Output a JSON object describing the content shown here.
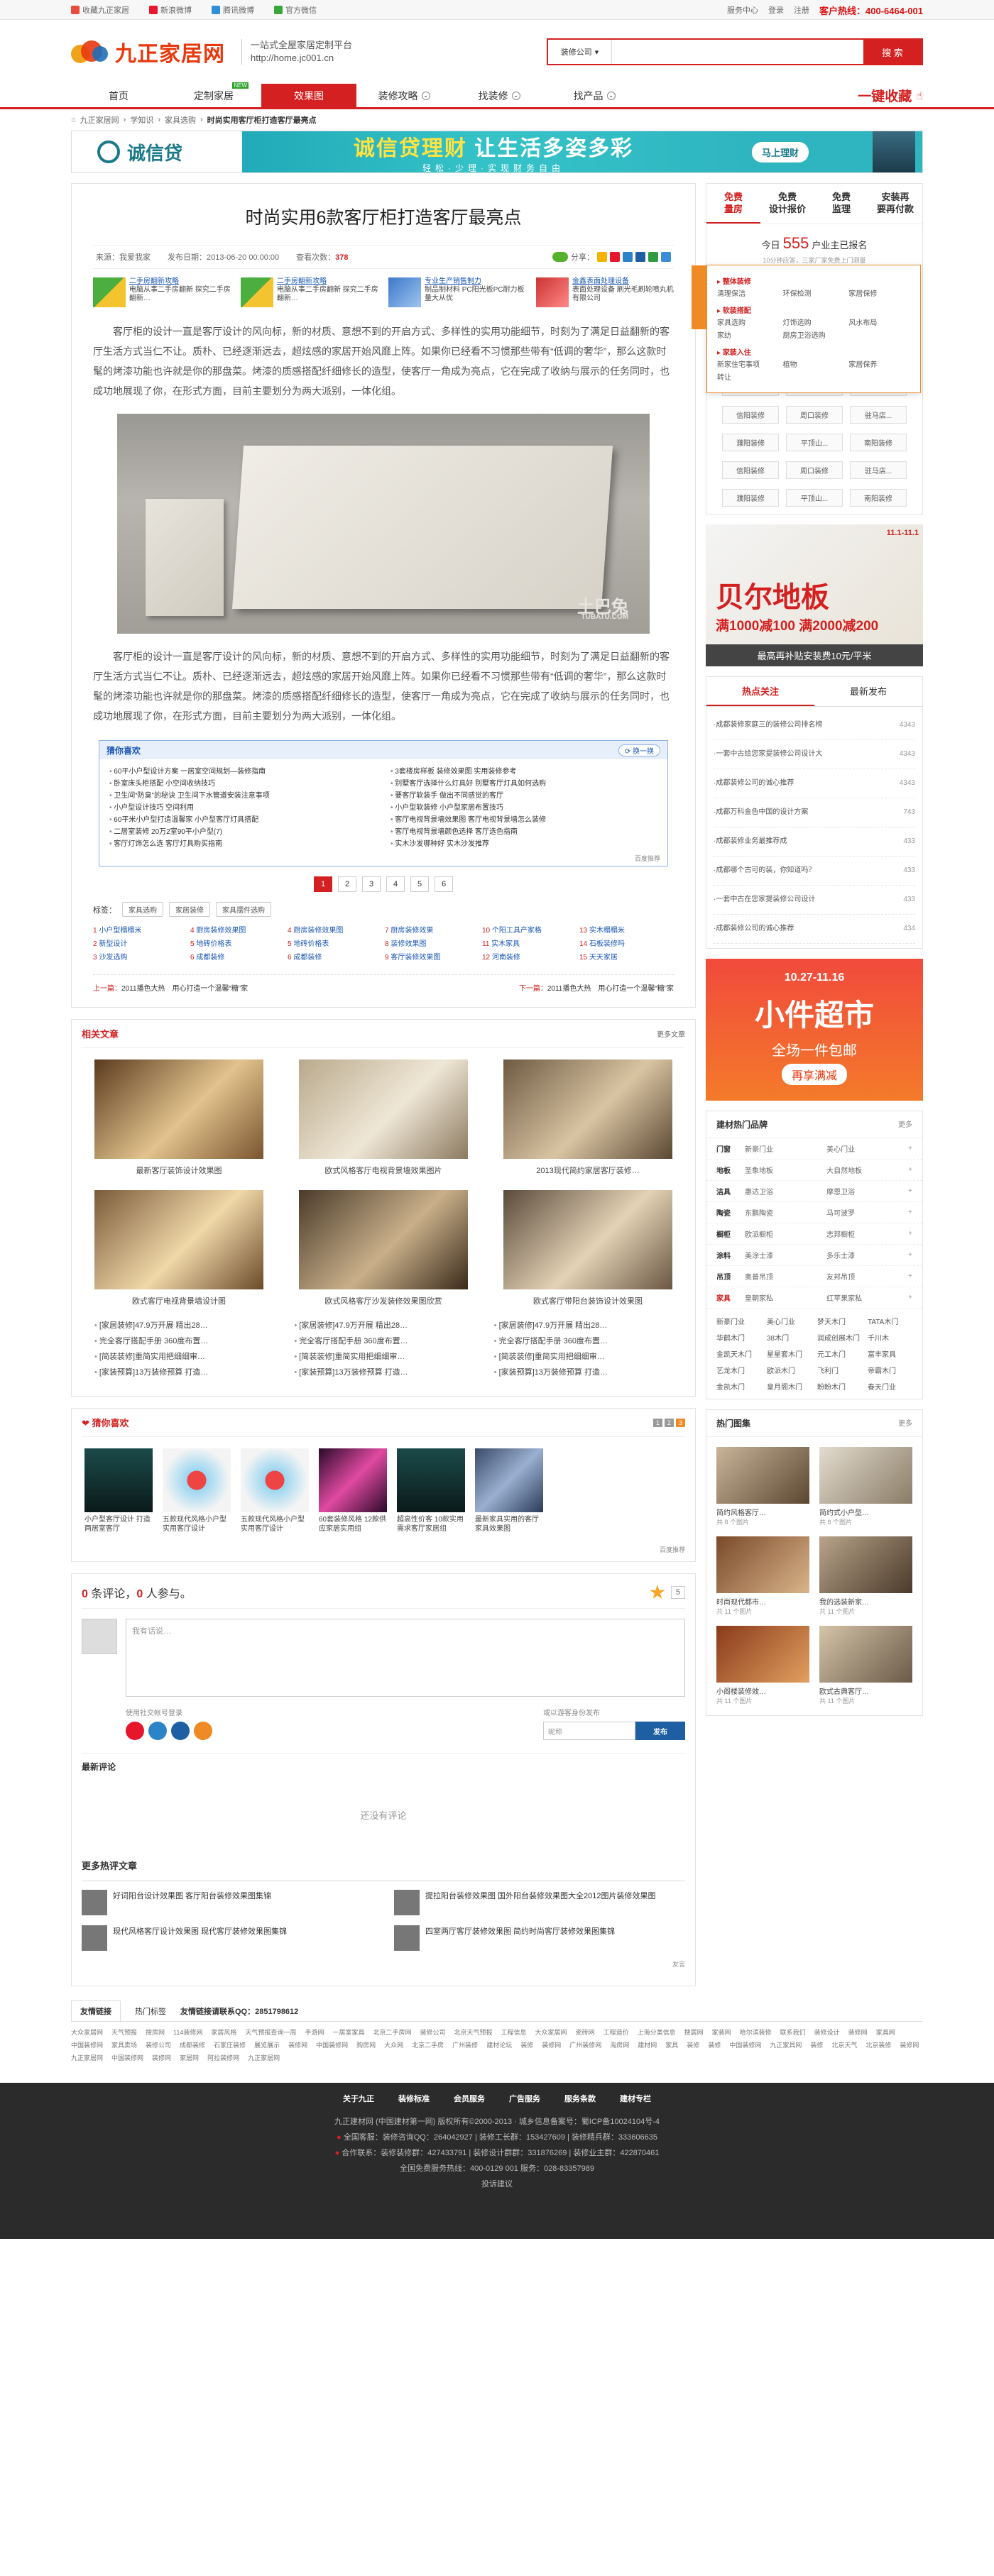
{
  "topbar": {
    "items": [
      "收藏九正家居",
      "新浪微博",
      "腾讯微博",
      "官方微信"
    ],
    "right": [
      "服务中心",
      "登录",
      "注册"
    ],
    "hotline": "客户热线：400-6464-001"
  },
  "logo": {
    "text": "九正家居网",
    "slogan_1": "一站式全屋家居定制平台",
    "slogan_2": "http://home.jc001.cn"
  },
  "search": {
    "select": "装修公司",
    "placeholder": "",
    "button": "搜 索"
  },
  "nav": {
    "items": [
      {
        "label": "首页"
      },
      {
        "label": "定制家居",
        "badge": "NEW"
      },
      {
        "label": "效果图",
        "active": true
      },
      {
        "label": "装修攻略",
        "more": true
      },
      {
        "label": "找装修",
        "more": true
      },
      {
        "label": "找产品",
        "more": true
      }
    ],
    "collect": "一键收藏"
  },
  "breadcrumb": [
    "九正家居网",
    "学知识",
    "家具选购",
    "时尚实用客厅柜打造客厅最亮点"
  ],
  "banner": {
    "brand": "诚信贷",
    "headline_a": "诚信贷理财",
    "headline_b": "让生活多姿多彩",
    "sub": "轻松·少理·实现财务自由",
    "button": "马上理财"
  },
  "article": {
    "title": "时尚实用6款客厅柜打造客厅最亮点",
    "meta": {
      "source": "来源：我爱我家",
      "time": "发布日期：2013-06-20 00:00:00",
      "views_label": "查看次数：",
      "views": "378"
    },
    "share_label": "分享：",
    "ads": [
      {
        "title": "二手房翻新攻略",
        "desc": "电脑从事二手房翻新 探究二手房翻新…"
      },
      {
        "title": "二手房翻新攻略",
        "desc": "电脑从事二手房翻新 探究二手房翻新…"
      },
      {
        "title": "专业生产销售制力",
        "desc": "制品制材料 PC阳光板PC耐力板量大从优"
      },
      {
        "title": "金鑫表面处理设备",
        "desc": "表面处理设备 刷光毛刷轮喷丸机 有限公司"
      }
    ],
    "para1": "客厅柜的设计一直是客厅设计的风向标，新的材质、意想不到的开启方式、多样性的实用功能细节，时刻为了满足日益翻新的客厅生活方式当仁不让。质朴、已经逐渐远去，超炫感的家居开始风靡上阵。如果你已经看不习惯那些带有“低调的奢华”，那么这款时髦的烤漆功能也许就是你的那盘菜。烤漆的质感搭配纤细修长的造型，使客厅一角成为亮点，它在完成了收纳与展示的任务同时，也成功地展现了你，在形式方面，目前主要划分为两大派别，一体化组。",
    "photo_wm": "土巴兔",
    "photo_wm_url": "TUBATU.COM",
    "para2": "客厅柜的设计一直是客厅设计的风向标，新的材质、意想不到的开启方式、多样性的实用功能细节，时刻为了满足日益翻新的客厅生活方式当仁不让。质朴、已经逐渐远去，超炫感的家居开始风靡上阵。如果你已经看不习惯那些带有“低调的奢华”，那么这款时髦的烤漆功能也许就是你的那盘菜。烤漆的质感搭配纤细修长的造型，使客厅一角成为亮点，它在完成了收纳与展示的任务同时，也成功地展现了你，在形式方面，目前主要划分为两大派别，一体化组。",
    "recommend": {
      "title": "猜你喜欢",
      "switch": "换一换",
      "items": [
        "60平小户型设计方案 一居室空间规划—装修指南",
        "3套楼房样板 装修效果图 实用装修参考",
        "卧室床头柜搭配 小空间收纳技巧",
        "别墅客厅选择什么灯具好 别墅客厅灯具如何选购",
        "卫生间“防臭”的秘诀 卫生间下水管道安装注意事项",
        "要客厅软装手 做出不同感觉的客厅",
        "小户型设计技巧 空间利用",
        "小户型软装修 小户型家居布置技巧",
        "60平米小户型打造温馨家 小户型客厅灯具搭配",
        "客厅电视背景墙效果图 客厅电视背景墙怎么装修",
        "二居室装修 20万2室90平小户型(7)",
        "客厅电视背景墙颜色选择 客厅选色指南",
        "客厅灯饰怎么选 客厅灯具购买指南",
        "实木沙发哪种好 实木沙发推荐"
      ],
      "footer": "百度推荐"
    },
    "pages": [
      "1",
      "2",
      "3",
      "4",
      "5",
      "6"
    ],
    "tags_label": "标签：",
    "tags": [
      "家具选购",
      "家居装修",
      "家具摆件选购"
    ],
    "keywords": [
      [
        "1",
        "小户型榻榻米"
      ],
      [
        "4",
        "厨房装修效果图"
      ],
      [
        "4",
        "厨房装修效果图"
      ],
      [
        "7",
        "厨房装修效果"
      ],
      [
        "10",
        "个阳工具产家格"
      ],
      [
        "13",
        "实木榻榻米"
      ],
      [
        "2",
        "新型设计"
      ],
      [
        "5",
        "地砖价格表"
      ],
      [
        "5",
        "地砖价格表"
      ],
      [
        "8",
        "装修效果图"
      ],
      [
        "11",
        "实木家具"
      ],
      [
        "14",
        "石板装修吗"
      ],
      [
        "3",
        "沙发选购"
      ],
      [
        "6",
        "成都装修"
      ],
      [
        "6",
        "成都装修"
      ],
      [
        "9",
        "客厅装修效果图"
      ],
      [
        "12",
        "河南装修"
      ],
      [
        "15",
        "天天家居"
      ]
    ],
    "prev": {
      "label": "上一篇：",
      "text": "2011播色大热　用心打造一个温馨“糖”家"
    },
    "next": {
      "label": "下一篇：",
      "text": "2011播色大热　用心打造一个温馨“糖”家"
    }
  },
  "related": {
    "title": "相关文章",
    "more": "更多文章",
    "items": [
      "最新客厅装饰设计效果图",
      "欧式风格客厅电视背景墙效果图片",
      "2013现代简约家居客厅装修…",
      "欧式客厅电视背景墙设计图",
      "欧式风格客厅沙发装修效果图欣赏",
      "欧式客厅带阳台装饰设计效果图"
    ],
    "list": [
      [
        "[家居装修]47.9万开展 精出28…",
        "[家居装修]47.9万开展 精出28…",
        "[家居装修]47.9万开展 精出28…"
      ],
      [
        "完全客厅搭配手册 360度布置…",
        "完全客厅搭配手册 360度布置…",
        "完全客厅搭配手册 360度布置…"
      ],
      [
        "[简装装修]重简实用把细细审…",
        "[简装装修]重简实用把细细审…",
        "[简装装修]重简实用把细细审…"
      ],
      [
        "[家装预算]13万装修预算 打造…",
        "[家装预算]13万装修预算 打造…",
        "[家装预算]13万装修预算 打造…"
      ]
    ]
  },
  "guess": {
    "title": "猜你喜欢",
    "pager": [
      "1",
      "2",
      "3"
    ],
    "items": [
      "小户型客厅设计 打造两居室客厅",
      "五款现代风格小户型实用客厅设计",
      "五款现代风格小户型实用客厅设计",
      "60套装修风格 12款供应家居实用组",
      "超高性价客 10款实用需求客厅家居组",
      "最新家具实用的客厅家具效果图"
    ],
    "footer": "百度推荐"
  },
  "comment": {
    "count": "0",
    "label_a": "条评论，",
    "people": "0",
    "label_b": "人参与。",
    "star_num": "5",
    "placeholder": "我有话说…",
    "social_label": "使用社交帐号登录",
    "anon_label": "或以游客身份发布",
    "nick_placeholder": "昵称",
    "publish": "发布",
    "latest_title": "最新评论",
    "empty": "还没有评论",
    "more_title": "更多热评文章",
    "hot": [
      "好词阳台设计效果图 客厅阳台装修效果图集锦",
      "提拉阳台装修效果图 国外阳台装修效果图大全2012图片装修效果图",
      "现代风格客厅设计效果图 现代客厅装修效果图集锦",
      "四室两厅客厅装修效果图 简约时尚客厅装修效果图集锦"
    ],
    "footer": "友言"
  },
  "friend": {
    "tabs": [
      "友情链接",
      "热门标签"
    ],
    "apply": "友情链接请联系QQ：2851798612",
    "links": [
      "大众家居网",
      "天气预报",
      "搜房网",
      "114装修网",
      "家居风格",
      "天气预报查询一周",
      "手游网",
      "一居室家具",
      "北京二手房网",
      "装修公司",
      "北京天气预报",
      "工程信息",
      "大众家居网",
      "瓷砖网",
      "工程造价",
      "上海分类信息",
      "搜居网",
      "家装网",
      "哈尔滨装修",
      "联系我们",
      "装修设计",
      "装修网",
      "家具网",
      "中国装修网",
      "家具卖场",
      "装修公司",
      "成都装修",
      "石家庄装修",
      "展览展示",
      "装修网",
      "中国装修网",
      "购房网",
      "大众网",
      "北京二手房",
      "广州装修",
      "建材论坛",
      "装修",
      "装修网",
      "广州装修网",
      "淘房网",
      "建材网",
      "家具",
      "装修",
      "装修",
      "中国装修网",
      "九正家具网",
      "装修",
      "北京天气",
      "北京装修",
      "装修网",
      "九正家居网",
      "中国装修网",
      "装修网",
      "家居网",
      "阿拉装修网",
      "九正家居网"
    ]
  },
  "footer": {
    "nav": [
      "关于九正",
      "装修标准",
      "会员服务",
      "广告服务",
      "服务条款",
      "建材专栏"
    ],
    "lines": [
      "九正建材网 (中国建材第一网) 版权所有©2000-2013 · 城乡信息备案号：蜀ICP备10024104号-4",
      "全国客服：装修咨询QQ：264042927 | 装修工长群：153427609 | 装修精兵群：333606635",
      "合作联系：装修装修群：427433791 | 装修设计群群：331876269 | 装修业主群：422870461",
      "全国免费服务热线：400-0129 001 服务：028-83357989",
      "投诉建议"
    ]
  },
  "sidebar": {
    "tabs": [
      [
        "免费",
        "量房"
      ],
      [
        "免费",
        "设计报价"
      ],
      [
        "免费",
        "监理"
      ],
      [
        "安装再",
        "要再付款"
      ]
    ],
    "today_label": "今日",
    "today_count": "555",
    "today_suffix": "户业主已报名",
    "sub": "10分钟应答，三家厂家免费上门测量",
    "dropdown": {
      "groups": [
        {
          "title": "整体装修",
          "items": [
            "清理保洁",
            "环保检测",
            "家居保修"
          ]
        },
        {
          "title": "软装搭配",
          "items": [
            "家具选购",
            "灯饰选购",
            "风水布局",
            "家纺",
            "厨房卫浴选购",
            ""
          ]
        },
        {
          "title": "家装入住",
          "items": [
            "新家住宅事项",
            "植物",
            "家居保养",
            "转让",
            "",
            ""
          ]
        }
      ]
    },
    "cities": [
      "濮阳装修",
      "平顶山...",
      "南阳装修",
      "信阳装修",
      "周口装修",
      "驻马店...",
      "濮阳装修",
      "平顶山...",
      "南阳装修",
      "信阳装修",
      "周口装修",
      "驻马店...",
      "濮阳装修",
      "平顶山...",
      "南阳装修"
    ],
    "ad1": {
      "brand": "贝尔地板",
      "line1": "满1000减100 满2000减200",
      "line2": "最高再补贴安装费10元/平米",
      "date": "11.1-11.1"
    },
    "hot": {
      "tabs": [
        "热点关注",
        "最新发布"
      ],
      "items": [
        [
          "·成都装修家庭三的装修公司排名榜",
          "4343"
        ],
        [
          "·一套中古给您家提装修公司设计大",
          "4343"
        ],
        [
          "·成都装修公司的诚心推荐",
          "4343"
        ],
        [
          "·成都万科金色中国的设计方案",
          "743"
        ],
        [
          "·成都装修业务最推荐成",
          "433"
        ],
        [
          "·成都哪个古可的装，你知道吗？",
          "433"
        ],
        [
          "·一套中古在您家提装修公司设计",
          "433"
        ],
        [
          "·成都装修公司的诚心推荐",
          "434"
        ]
      ]
    },
    "ad2": {
      "date": "10.27-11.16",
      "title": "小件超市",
      "line1": "全场一件包邮",
      "line2": "再享满减"
    },
    "brand": {
      "title": "建材热门品牌",
      "more": "更多",
      "rows": [
        [
          "门窗",
          "新豪门业",
          "美心门业"
        ],
        [
          "地板",
          "圣象地板",
          "大自然地板"
        ],
        [
          "洁具",
          "惠达卫浴",
          "摩恩卫浴"
        ],
        [
          "陶瓷",
          "东鹏陶瓷",
          "马可波罗"
        ],
        [
          "橱柜",
          "欧派橱柜",
          "志邦橱柜"
        ],
        [
          "涂料",
          "美涂士漆",
          "多乐士漆"
        ],
        [
          "吊顶",
          "奥普吊顶",
          "友邦吊顶"
        ],
        [
          "家具",
          "皇朝家私",
          "红苹果家私"
        ]
      ],
      "logos": [
        "新豪门业",
        "美心门业",
        "梦天木门",
        "TATA木门",
        "华鹤木门",
        "38木门",
        "润成创展木门",
        "千川木",
        "金凯天木门",
        "星星套木门",
        "元工木门",
        "富丰家具",
        "艺龙木门",
        "欧派木门",
        "飞利门",
        "帝霸木门",
        "金凯木门",
        "皇月阁木门",
        "盼盼木门",
        "春天门业"
      ]
    },
    "pics": {
      "title": "热门图集",
      "more": "更多",
      "items": [
        [
          "简约风格客厅…",
          "共 8 个图片"
        ],
        [
          "简约式小户型…",
          "共 8 个图片"
        ],
        [
          "时尚现代都市…",
          "共 11 个图片"
        ],
        [
          "我的选装新家…",
          "共 11 个图片"
        ],
        [
          "小阁楼装修效…",
          "共 11 个图片"
        ],
        [
          "欧式古典客厅…",
          "共 11 个图片"
        ]
      ]
    }
  }
}
